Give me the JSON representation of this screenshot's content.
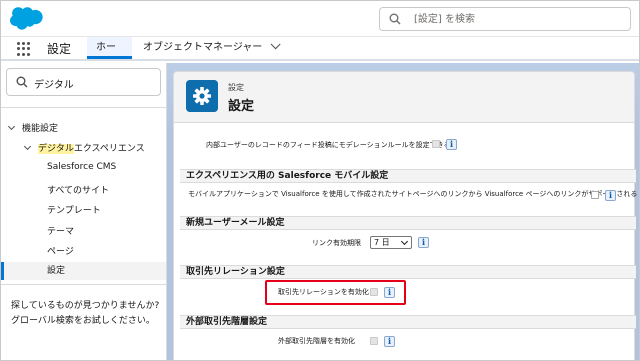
{
  "header": {
    "logo": "salesforce-cloud-logo",
    "search_placeholder": "[設定] を検索",
    "brand_color": "#00a1e0"
  },
  "nav": {
    "app_name": "設定",
    "tabs": [
      {
        "label": "ホーム",
        "active": true
      },
      {
        "label": "オブジェクトマネージャー",
        "active": false
      }
    ]
  },
  "sidebar": {
    "quickfind_value": "デジタル",
    "tree": {
      "root_label": "機能設定",
      "group_label_highlight": "デジタル",
      "group_label_rest": "エクスペリエンス",
      "items": [
        {
          "label": "Salesforce CMS"
        },
        {
          "label": "すべてのサイト"
        },
        {
          "label": "テンプレート"
        },
        {
          "label": "テーマ"
        },
        {
          "label": "ページ"
        },
        {
          "label": "設定",
          "selected": true
        }
      ]
    },
    "help_line1": "探しているものが見つかりませんか?",
    "help_line2": "グローバル検索をお試しください。"
  },
  "page_header": {
    "breadcrumb": "設定",
    "title": "設定",
    "icon": "gear-icon"
  },
  "content": {
    "top_row": "内部ユーザーのレコードのフィード投稿にモデレーションルールを設定できる",
    "sections": [
      {
        "title": "エクスペリエンス用の Salesforce モバイル設定",
        "row": "モバイルアプリケーションで Visualforce を使用して作成されたサイトページへのリンクから Visualforce ページへのリンクがサポートされる"
      },
      {
        "title": "新規ユーザーメール設定",
        "row": "リンク有効期限",
        "select_value": "7 日"
      },
      {
        "title": "取引先リレーション設定",
        "row": "取引先リレーションを有効化"
      },
      {
        "title": "外部取引先階層設定",
        "row": "外部取引先階層を有効化"
      }
    ]
  }
}
